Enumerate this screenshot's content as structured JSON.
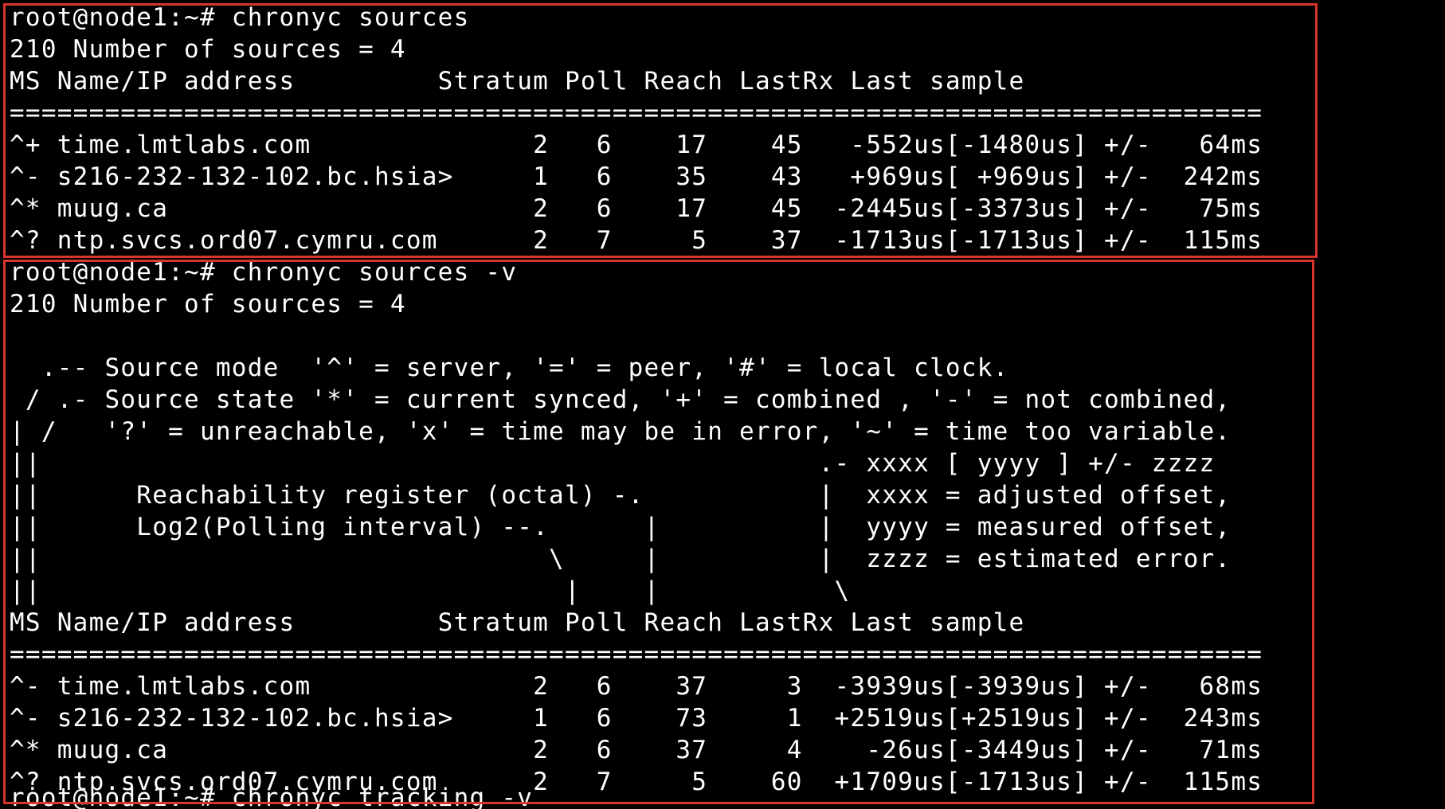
{
  "terminal": {
    "highlight_color": "#d8362a",
    "background": "#000000",
    "foreground": "#ffffff",
    "session_1": {
      "prompt_line": "root@node1:~# chronyc sources",
      "lines": [
        "210 Number of sources = 4",
        "MS Name/IP address         Stratum Poll Reach LastRx Last sample",
        "===============================================================================",
        "^+ time.lmtlabs.com              2   6    17    45   -552us[-1480us] +/-   64ms",
        "^- s216-232-132-102.bc.hsia>     1   6    35    43   +969us[ +969us] +/-  242ms",
        "^* muug.ca                       2   6    17    45  -2445us[-3373us] +/-   75ms",
        "^? ntp.svcs.ord07.cymru.com      2   7     5    37  -1713us[-1713us] +/-  115ms"
      ]
    },
    "session_2": {
      "prompt_line": "root@node1:~# chronyc sources -v",
      "lines": [
        "210 Number of sources = 4",
        "",
        "  .-- Source mode  '^' = server, '=' = peer, '#' = local clock.",
        " / .- Source state '*' = current synced, '+' = combined , '-' = not combined,",
        "| /   '?' = unreachable, 'x' = time may be in error, '~' = time too variable.",
        "||                                                 .- xxxx [ yyyy ] +/- zzzz",
        "||      Reachability register (octal) -.           |  xxxx = adjusted offset,",
        "||      Log2(Polling interval) --.      |          |  yyyy = measured offset,",
        "||                                \\     |          |  zzzz = estimated error.",
        "||                                 |    |           \\",
        "MS Name/IP address         Stratum Poll Reach LastRx Last sample",
        "===============================================================================",
        "^- time.lmtlabs.com              2   6    37     3  -3939us[-3939us] +/-   68ms",
        "^- s216-232-132-102.bc.hsia>     1   6    73     1  +2519us[+2519us] +/-  243ms",
        "^* muug.ca                       2   6    37     4    -26us[-3449us] +/-   71ms",
        "^? ntp.svcs.ord07.cymru.com      2   7     5    60  +1709us[-1713us] +/-  115ms"
      ]
    },
    "partial_next_prompt": "root@node1:~# chronyc tracking -v"
  }
}
